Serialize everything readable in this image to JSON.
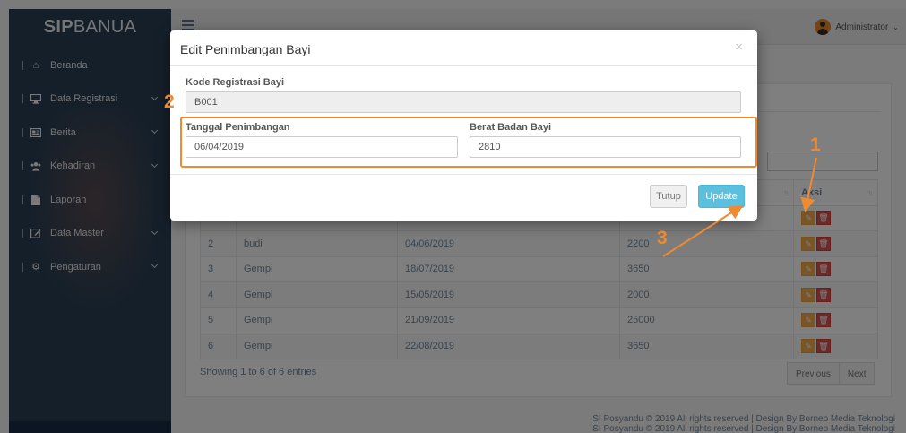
{
  "app": {
    "brand_bold": "SIP",
    "brand_rest": "BANUA"
  },
  "sidebar": {
    "items": [
      {
        "label": "Beranda",
        "icon": "home-icon"
      },
      {
        "label": "Data Registrasi",
        "icon": "desktop-icon"
      },
      {
        "label": "Berita",
        "icon": "newspaper-icon"
      },
      {
        "label": "Kehadiran",
        "icon": "users-icon"
      },
      {
        "label": "Laporan",
        "icon": "file-icon"
      },
      {
        "label": "Data Master",
        "icon": "edit-icon"
      },
      {
        "label": "Pengaturan",
        "icon": "gear-icon"
      }
    ]
  },
  "topnav": {
    "user": "Administrator"
  },
  "table": {
    "action_header": "Aksi",
    "rows": [
      {
        "no": "2",
        "name": "budi",
        "date": "04/06/2019",
        "weight": "2200"
      },
      {
        "no": "3",
        "name": "Gempi",
        "date": "18/07/2019",
        "weight": "3650"
      },
      {
        "no": "4",
        "name": "Gempi",
        "date": "15/05/2019",
        "weight": "2000"
      },
      {
        "no": "5",
        "name": "Gempi",
        "date": "21/09/2019",
        "weight": "25000"
      },
      {
        "no": "6",
        "name": "Gempi",
        "date": "22/08/2019",
        "weight": "3650"
      }
    ],
    "info": "Showing 1 to 6 of 6 entries",
    "prev": "Previous",
    "next": "Next"
  },
  "footer": "SI Posyandu © 2019 All rights reserved | Design By Borneo Media Teknologi",
  "modal": {
    "title": "Edit Penimbangan Bayi",
    "close": "×",
    "kode_label": "Kode Registrasi Bayi",
    "kode_value": "B001",
    "tanggal_label": "Tanggal Penimbangan",
    "tanggal_value": "06/04/2019",
    "berat_label": "Berat Badan Bayi",
    "berat_value": "2810",
    "tutup": "Tutup",
    "update": "Update"
  },
  "annotations": {
    "n1": "1",
    "n2": "2",
    "n3": "3",
    "color": "#ef8a2f"
  }
}
